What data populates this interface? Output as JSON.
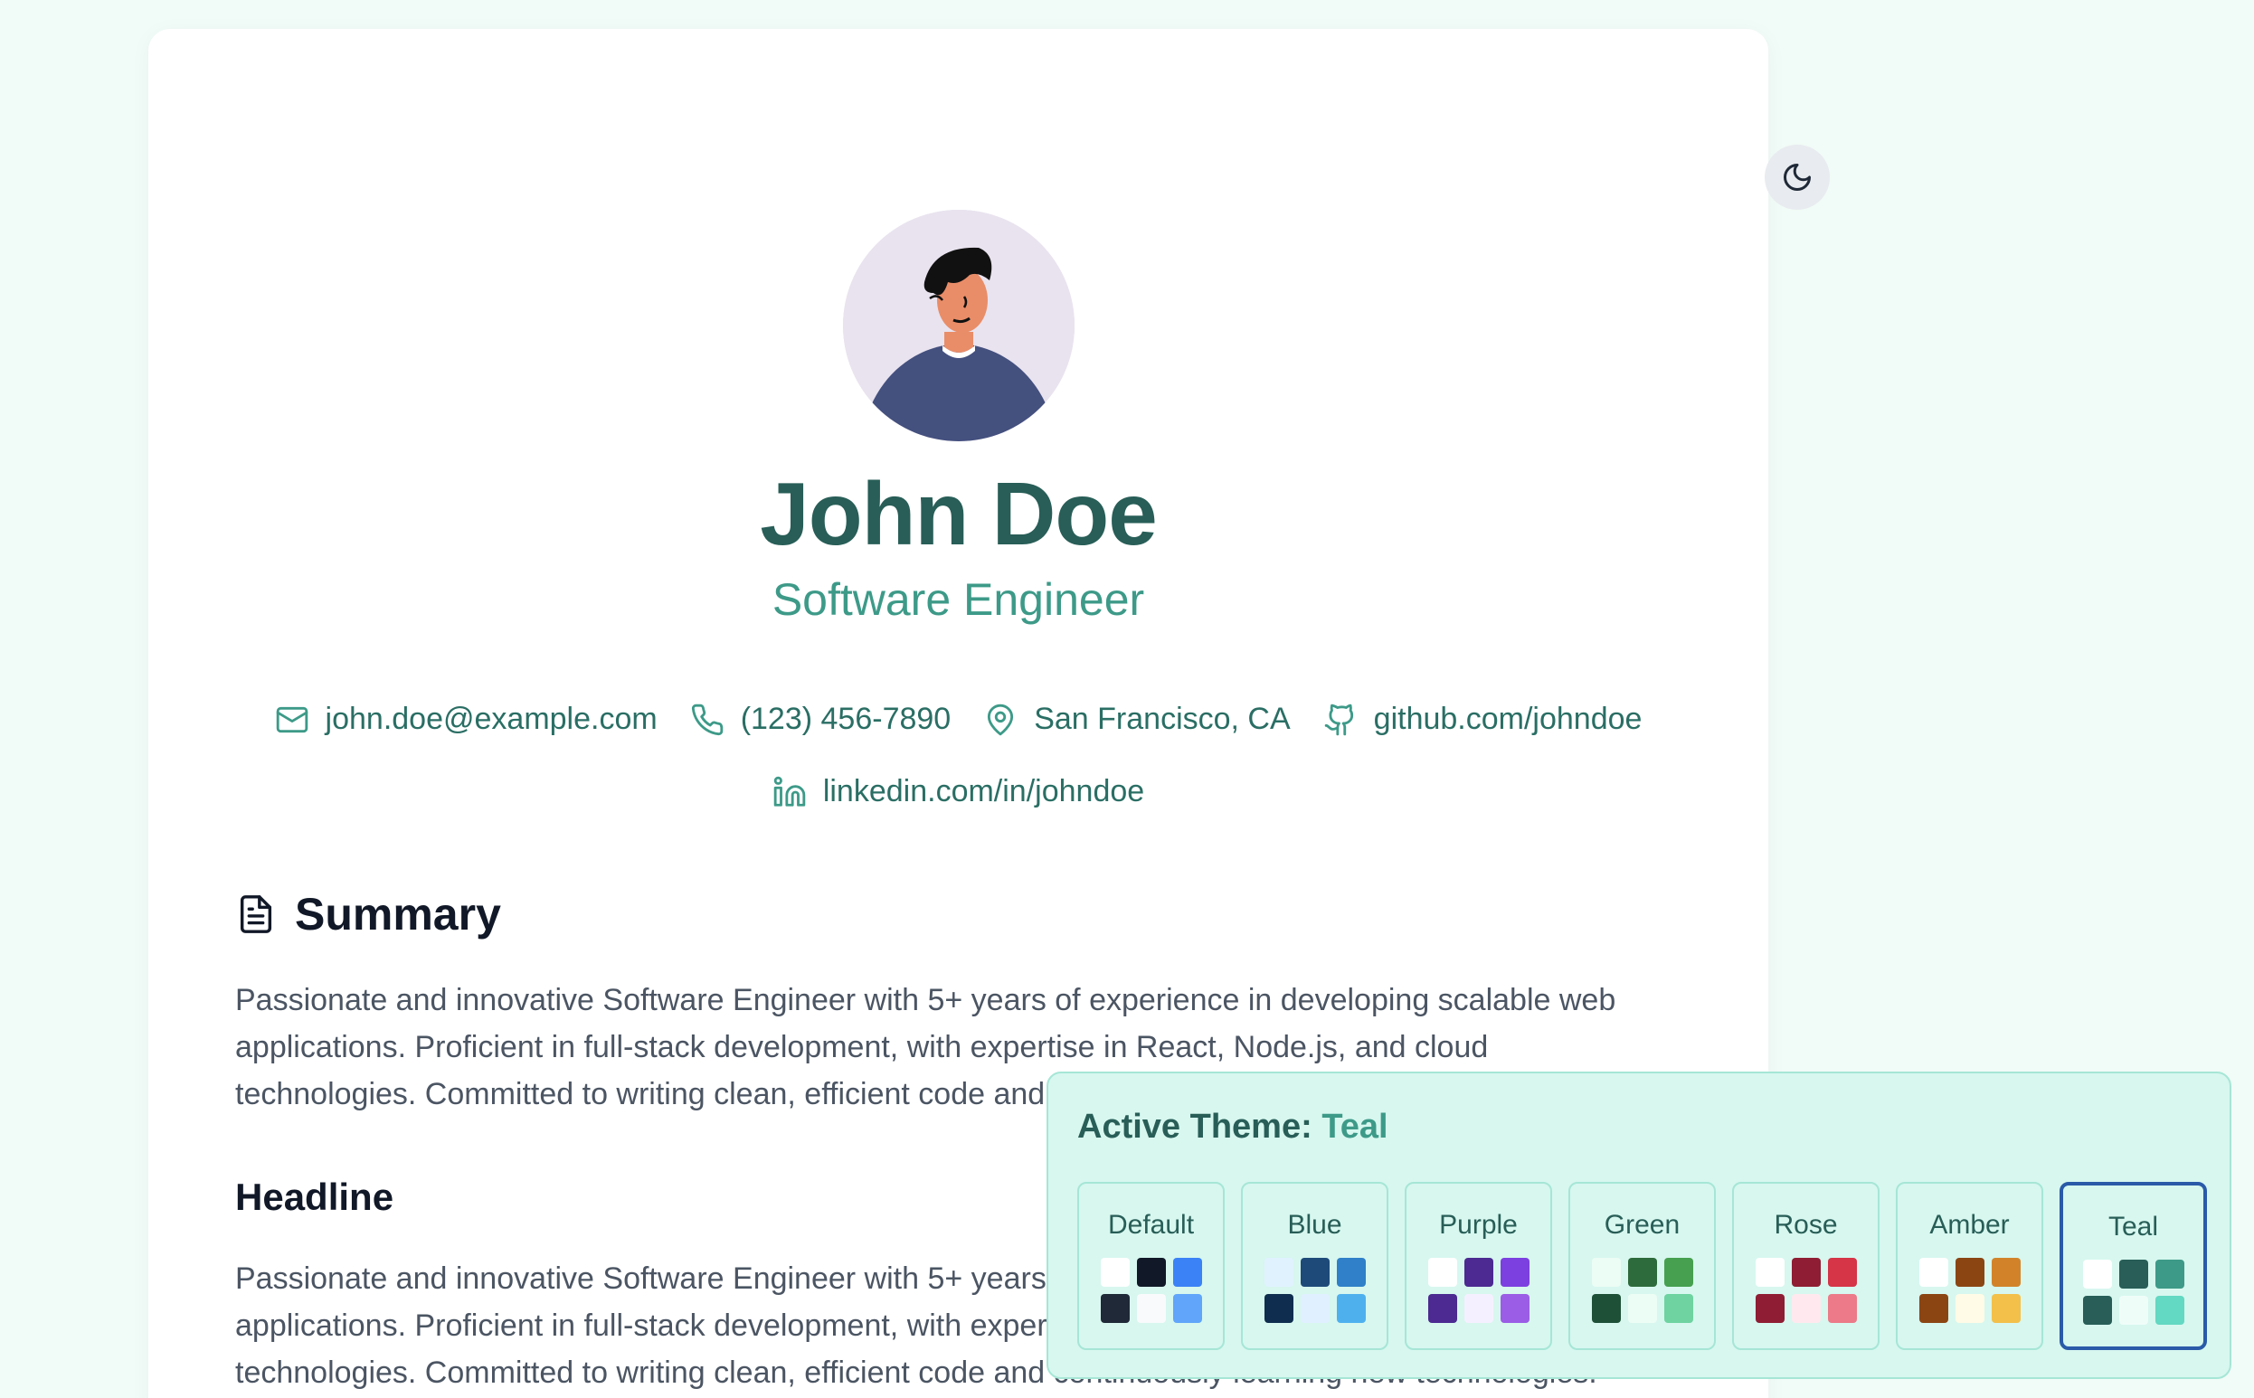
{
  "profile": {
    "name": "John Doe",
    "title": "Software Engineer"
  },
  "contacts": {
    "email": "john.doe@example.com",
    "phone": "(123) 456-7890",
    "location": "San Francisco, CA",
    "github": "github.com/johndoe",
    "linkedin": "linkedin.com/in/johndoe"
  },
  "summary": {
    "heading": "Summary",
    "text": "Passionate and innovative Software Engineer with 5+ years of experience in developing scalable web applications. Proficient in full-stack development, with expertise in React, Node.js, and cloud technologies. Committed to writing clean, efficient code and continuously learning new technologies."
  },
  "headline": {
    "heading": "Headline",
    "text": "Passionate and innovative Software Engineer with 5+ years of experience in developing scalable web applications. Proficient in full-stack development, with expertise in React, Node.js, and cloud technologies. Committed to writing clean, efficient code and continuously learning new technologies."
  },
  "theme_panel": {
    "label": "Active Theme:",
    "active": "Teal",
    "themes": [
      {
        "name": "Default",
        "colors": [
          "#ffffff",
          "#111827",
          "#3b82f6",
          "#1f2937",
          "#f9fafb",
          "#60a5fa"
        ]
      },
      {
        "name": "Blue",
        "colors": [
          "#e0f2fe",
          "#1e4a7a",
          "#2f80c8",
          "#0f2d4e",
          "#e0f0ff",
          "#4fb0ee"
        ]
      },
      {
        "name": "Purple",
        "colors": [
          "#ffffff",
          "#4c2a91",
          "#7c3fe0",
          "#4c2a91",
          "#f5f0ff",
          "#9b5de5"
        ]
      },
      {
        "name": "Green",
        "colors": [
          "#ecfdf5",
          "#2e6b3c",
          "#47a04f",
          "#1e5038",
          "#ecfdf5",
          "#6ed3a0"
        ]
      },
      {
        "name": "Rose",
        "colors": [
          "#ffffff",
          "#8f1d33",
          "#d63447",
          "#8f1d33",
          "#ffe9ee",
          "#ec7a88"
        ]
      },
      {
        "name": "Amber",
        "colors": [
          "#ffffff",
          "#8b4513",
          "#d2832a",
          "#8b4513",
          "#fffbe6",
          "#f3c04a"
        ]
      },
      {
        "name": "Teal",
        "colors": [
          "#ffffff",
          "#285e57",
          "#3d9a88",
          "#285e57",
          "#effdf9",
          "#63d8c2"
        ]
      }
    ]
  },
  "icons": {
    "theme_toggle": "moon-icon",
    "email": "mail-icon",
    "phone": "phone-icon",
    "location": "map-pin-icon",
    "github": "github-icon",
    "linkedin": "linkedin-icon",
    "summary": "file-text-icon"
  },
  "colors": {
    "accent": "#3d9a88",
    "accent_dark": "#285e57",
    "panel_bg": "#d7f7ef",
    "active_outline": "#2a5aa8"
  }
}
